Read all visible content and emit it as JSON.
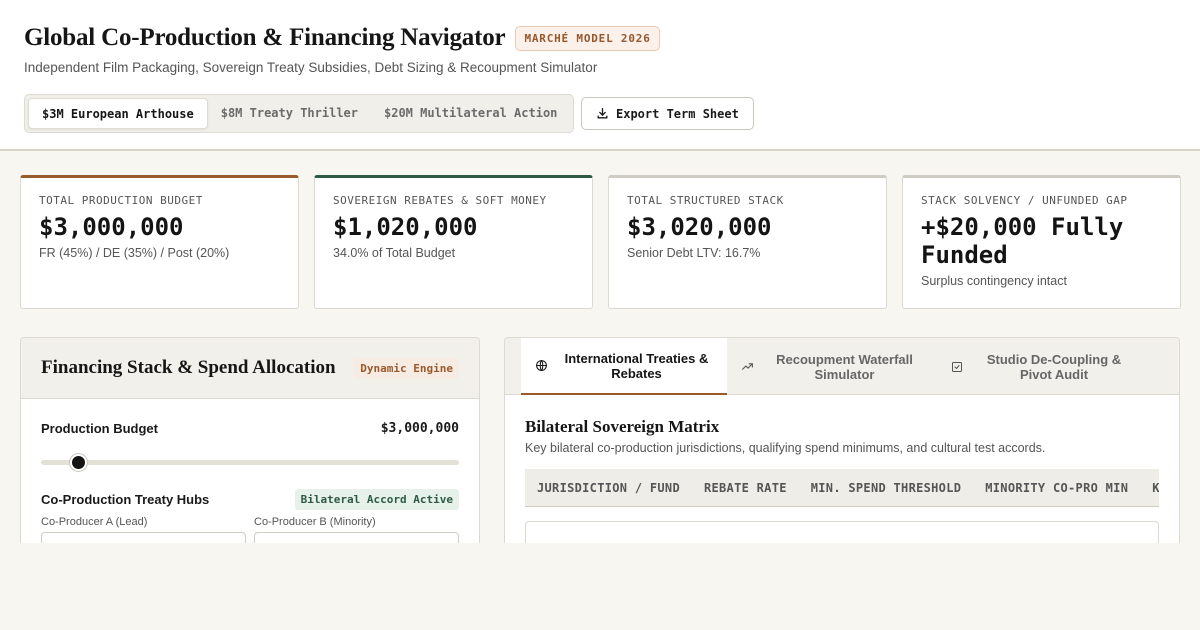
{
  "header": {
    "title": "Global Co-Production & Financing Navigator",
    "model_badge": "MARCHÉ MODEL 2026",
    "subtitle": "Independent Film Packaging, Sovereign Treaty Subsidies, Debt Sizing & Recoupment Simulator",
    "scenarios": [
      {
        "label": "$3M European Arthouse",
        "active": true
      },
      {
        "label": "$8M Treaty Thriller",
        "active": false
      },
      {
        "label": "$20M Multilateral Action",
        "active": false
      }
    ],
    "export_label": "Export Term Sheet"
  },
  "kpis": [
    {
      "label": "TOTAL PRODUCTION BUDGET",
      "value": "$3,000,000",
      "sub": "FR (45%) / DE (35%) / Post (20%)",
      "accent": "#9a5a2c"
    },
    {
      "label": "SOVEREIGN REBATES & SOFT MONEY",
      "value": "$1,020,000",
      "sub": "34.0% of Total Budget",
      "accent": "#2d5a45"
    },
    {
      "label": "TOTAL STRUCTURED STACK",
      "value": "$3,020,000",
      "sub": "Senior Debt LTV: 16.7%",
      "accent": "#cfccc3"
    },
    {
      "label": "STACK SOLVENCY / UNFUNDED GAP",
      "value": "+$20,000 Fully Funded",
      "sub": "Surplus contingency intact",
      "accent": "#cfccc3"
    }
  ],
  "left_panel": {
    "title": "Financing Stack & Spend Allocation",
    "badge": "Dynamic Engine",
    "budget_label": "Production Budget",
    "budget_value": "$3,000,000",
    "budget_slider_fraction": 0.09,
    "treaty_label": "Co-Production Treaty Hubs",
    "treaty_badge": "Bilateral Accord Active",
    "co_producer_a_label": "Co-Producer A (Lead)",
    "co_producer_b_label": "Co-Producer B (Minority)"
  },
  "right_panel": {
    "tabs": [
      {
        "label": "International Treaties & Rebates",
        "icon": "globe-icon",
        "active": true
      },
      {
        "label": "Recoupment Waterfall Simulator",
        "icon": "trending-up-icon",
        "active": false
      },
      {
        "label": "Studio De-Coupling & Pivot Audit",
        "icon": "check-square-icon",
        "active": false
      }
    ],
    "section_title": "Bilateral Sovereign Matrix",
    "section_desc": "Key bilateral co-production jurisdictions, qualifying spend minimums, and cultural test accords.",
    "columns": [
      "JURISDICTION / FUND",
      "REBATE RATE",
      "MIN. SPEND THRESHOLD",
      "MINORITY CO-PRO MIN",
      "KE"
    ]
  },
  "colors": {
    "accent_brown": "#9a5a2c",
    "accent_green": "#2d5a45"
  }
}
